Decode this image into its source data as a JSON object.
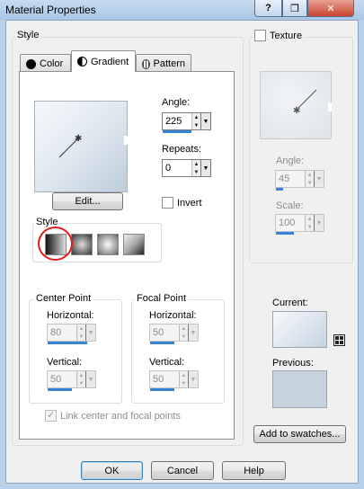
{
  "window": {
    "title": "Material Properties",
    "help_glyph": "?",
    "pin_glyph": "❒",
    "close_glyph": "✕"
  },
  "style_group": {
    "label": "Style",
    "tabs": [
      {
        "label": "Color",
        "icon": "filled-circle-icon"
      },
      {
        "label": "Gradient",
        "icon": "half-circle-icon",
        "active": true
      },
      {
        "label": "Pattern",
        "icon": "pattern-grid-icon"
      }
    ]
  },
  "gradient": {
    "edit_label": "Edit...",
    "angle_label": "Angle:",
    "angle_value": "225",
    "repeats_label": "Repeats:",
    "repeats_value": "0",
    "invert_label": "Invert",
    "style_label": "Style",
    "styles": [
      "linear",
      "rectangular",
      "sunburst",
      "radial-corner"
    ]
  },
  "center_point": {
    "label": "Center Point",
    "horizontal_label": "Horizontal:",
    "horizontal_value": "80",
    "vertical_label": "Vertical:",
    "vertical_value": "50"
  },
  "focal_point": {
    "label": "Focal Point",
    "horizontal_label": "Horizontal:",
    "horizontal_value": "50",
    "vertical_label": "Vertical:",
    "vertical_value": "50"
  },
  "link_label": "Link center and focal points",
  "texture": {
    "label": "Texture",
    "angle_label": "Angle:",
    "angle_value": "45",
    "scale_label": "Scale:",
    "scale_value": "100"
  },
  "swatches": {
    "current_label": "Current:",
    "previous_label": "Previous:",
    "add_label": "Add to swatches..."
  },
  "buttons": {
    "ok": "OK",
    "cancel": "Cancel",
    "help": "Help"
  },
  "colors": {
    "accent": "#3883d8",
    "highlight_circle": "#e01818",
    "gradient_light": "#f6f9fc",
    "gradient_dark": "#bccddc"
  }
}
